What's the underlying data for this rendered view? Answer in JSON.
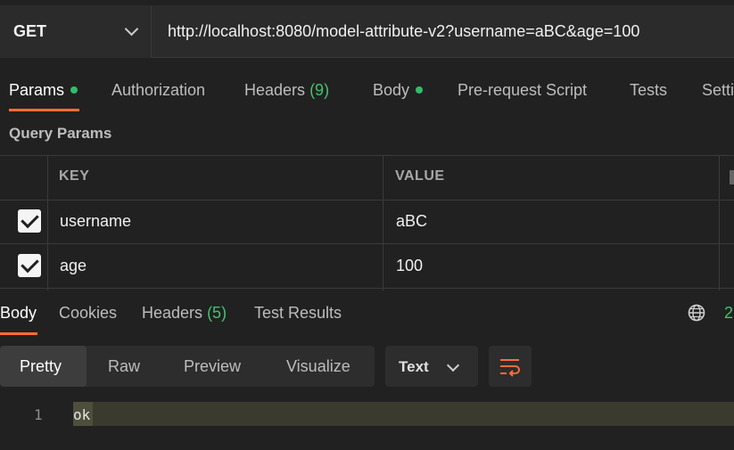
{
  "request": {
    "method": "GET",
    "url": "http://localhost:8080/model-attribute-v2?username=aBC&age=100"
  },
  "request_tabs": {
    "params": "Params",
    "authorization": "Authorization",
    "headers": "Headers",
    "headers_count": "(9)",
    "body": "Body",
    "pre_request": "Pre-request Script",
    "tests": "Tests",
    "settings": "Setti"
  },
  "query_params": {
    "title": "Query Params",
    "key_header": "KEY",
    "value_header": "VALUE",
    "rows": [
      {
        "key": "username",
        "value": "aBC",
        "checked": true
      },
      {
        "key": "age",
        "value": "100",
        "checked": true
      }
    ]
  },
  "response_tabs": {
    "body": "Body",
    "cookies": "Cookies",
    "headers": "Headers",
    "headers_count": "(5)",
    "test_results": "Test Results",
    "status_partial": "2",
    "globe_icon": "globe-icon"
  },
  "view_modes": {
    "pretty": "Pretty",
    "raw": "Raw",
    "preview": "Preview",
    "visualize": "Visualize",
    "format": "Text",
    "wrap_icon": "wrap-lines-icon"
  },
  "response_body": {
    "line_number": "1",
    "content": "ok"
  },
  "colors": {
    "accent": "#ff6c37",
    "green": "#45c26e"
  }
}
